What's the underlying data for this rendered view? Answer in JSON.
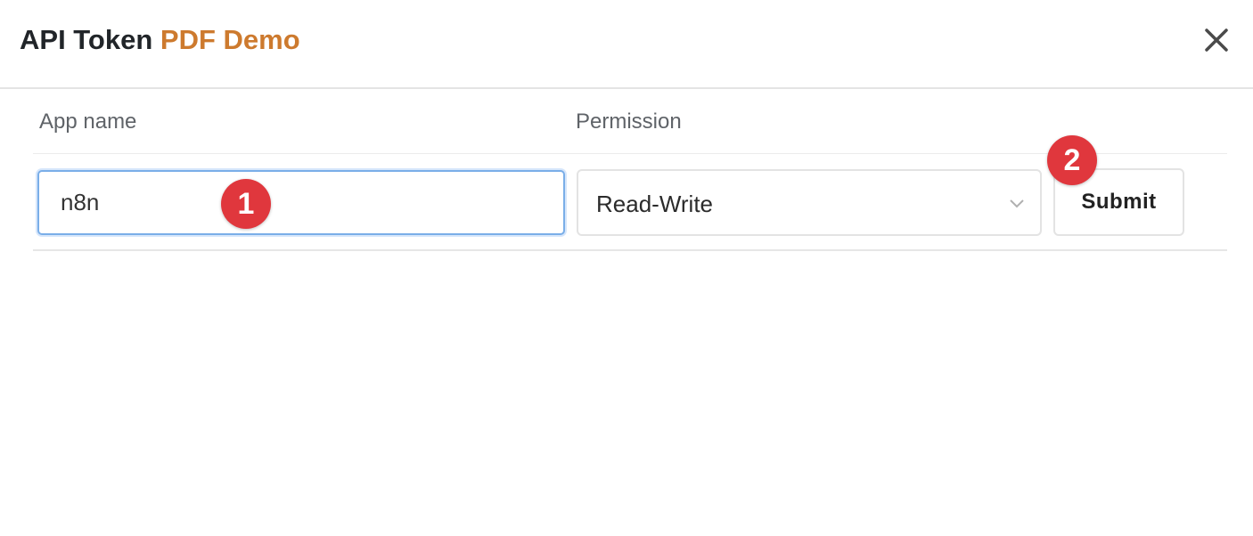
{
  "dialog": {
    "title_main": "API Token",
    "title_accent": "PDF Demo",
    "accent_color": "#cd7a2e",
    "close_icon": "close-icon"
  },
  "table": {
    "headers": {
      "app_name": "App name",
      "permission": "Permission"
    },
    "row": {
      "app_name_value": "n8n",
      "permission_selected": "Read-Write",
      "submit_label": "Submit"
    }
  },
  "annotations": {
    "marker_1": "1",
    "marker_2": "2",
    "marker_color": "#e0373d"
  }
}
